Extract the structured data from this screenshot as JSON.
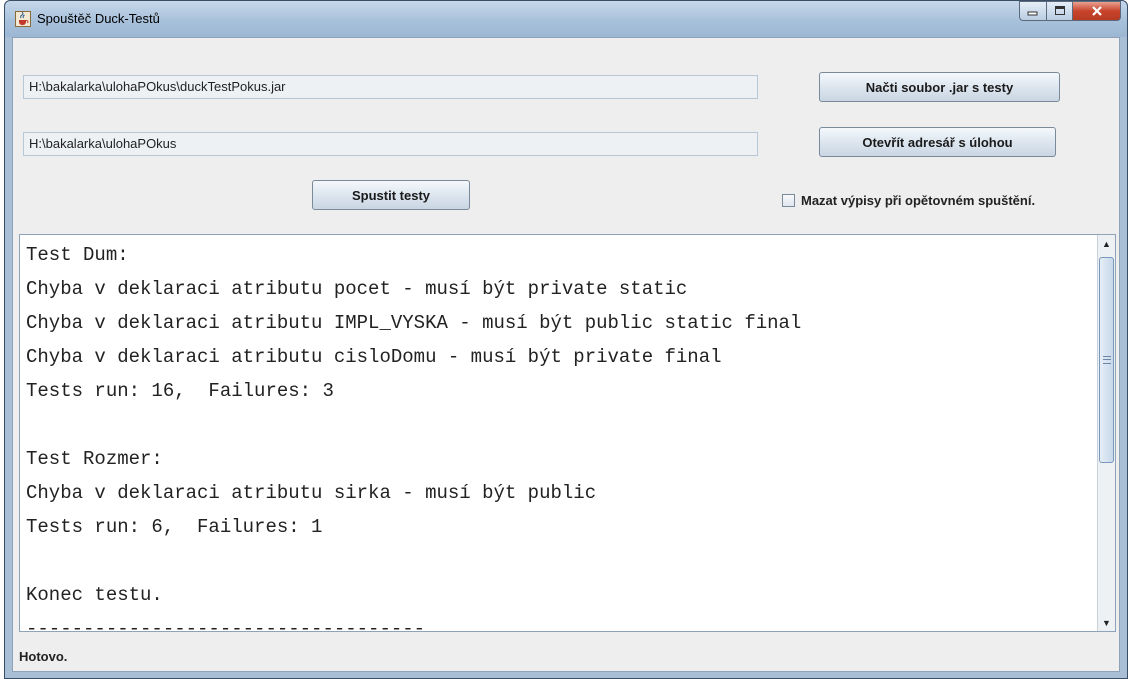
{
  "window": {
    "title": "Spouštěč Duck-Testů",
    "icon": "java-cup-icon"
  },
  "fields": {
    "jar_path": "H:\\bakalarka\\ulohaPOkus\\duckTestPokus.jar",
    "task_dir": "H:\\bakalarka\\ulohaPOkus"
  },
  "buttons": {
    "load_jar": "Načti soubor .jar s testy",
    "open_dir": "Otevřít adresář s úlohou",
    "run_tests": "Spustit testy"
  },
  "options": {
    "clear_output_label": "Mazat výpisy při opětovném spuštění.",
    "clear_output_checked": false
  },
  "output": {
    "lines": [
      "Test Dum:",
      "Chyba v deklaraci atributu pocet - musí být private static",
      "Chyba v deklaraci atributu IMPL_VYSKA - musí být public static final",
      "Chyba v deklaraci atributu cisloDomu - musí být private final",
      "Tests run: 16,  Failures: 3",
      "",
      "Test Rozmer:",
      "Chyba v deklaraci atributu sirka - musí být public",
      "Tests run: 6,  Failures: 1",
      "",
      "Konec testu.",
      "-----------------------------------"
    ]
  },
  "status": {
    "text": "Hotovo."
  }
}
